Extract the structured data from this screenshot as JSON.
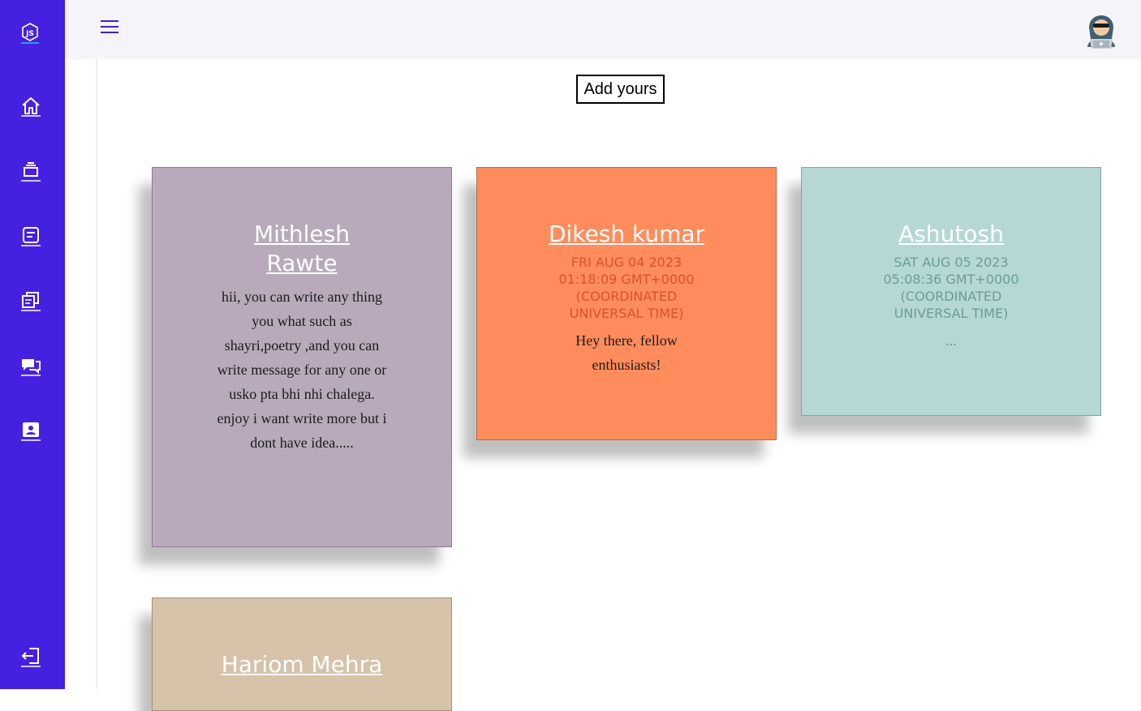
{
  "topbar": {
    "menu_icon": "hamburger-icon",
    "avatar_icon": "hacker-avatar-icon"
  },
  "sidebar": {
    "logo_icon": "nodejs-logo-icon",
    "items": [
      {
        "icon": "home-icon"
      },
      {
        "icon": "layers-icon"
      },
      {
        "icon": "note-icon"
      },
      {
        "icon": "documents-icon"
      },
      {
        "icon": "chat-icon"
      },
      {
        "icon": "contact-card-icon"
      }
    ],
    "logout_icon": "logout-icon"
  },
  "main": {
    "add_button_label": "Add yours"
  },
  "cards": [
    {
      "name": "Mithlesh Rawte",
      "date": "",
      "message": "hii, you can write any thing you what such as shayri,poetry ,and you can write message for any one or usko pta bhi nhi chalega. enjoy i want write more but i dont have idea.....",
      "bg": "#b8a9bb",
      "date_color": "#7a6b7e"
    },
    {
      "name": "Dikesh kumar",
      "date": "FRI AUG 04 2023 01:18:09 GMT+0000 (COORDINATED UNIVERSAL TIME)",
      "message": "Hey there, fellow enthusiasts!",
      "bg": "#ff8c5c",
      "date_color": "#d9532c"
    },
    {
      "name": "Ashutosh",
      "date": "SAT AUG 05 2023 05:08:36 GMT+0000 (COORDINATED UNIVERSAL TIME)",
      "message": "...",
      "bg": "#b5d8d7",
      "date_color": "#6e9a99"
    },
    {
      "name": "Hariom Mehra",
      "date": "",
      "message": "",
      "bg": "#d7c3a9",
      "date_color": "#9c8468"
    }
  ]
}
